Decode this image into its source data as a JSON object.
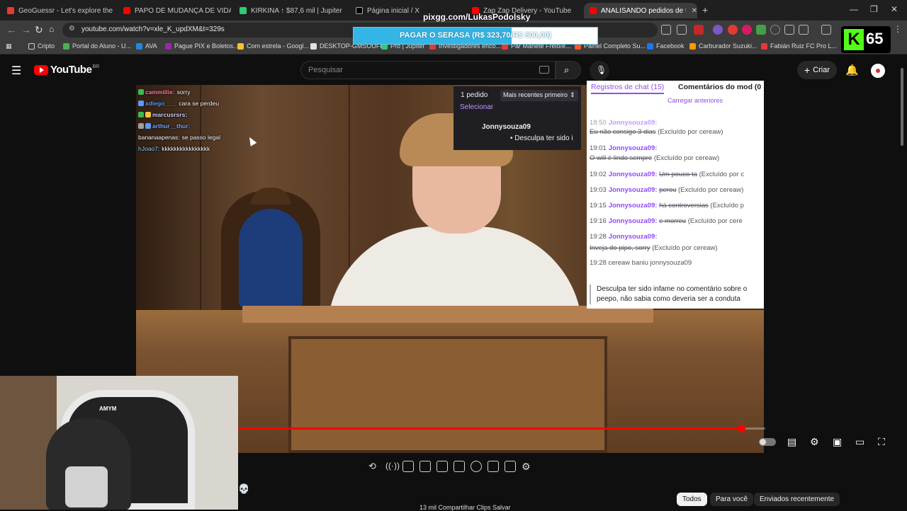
{
  "browser": {
    "tabs": [
      {
        "title": "GeoGuessr - Let's explore the world!",
        "color": "#e53935"
      },
      {
        "title": "PAPO DE MUDANÇA DE VIDA COM",
        "color": "#ff0000"
      },
      {
        "title": "KIRKINA ↑ $87,6 mil | Jupiter",
        "color": "#2ecc71"
      },
      {
        "title": "Página inicial / X",
        "color": "#000000"
      },
      {
        "title": "Zap Zap Delivery - YouTube",
        "color": "#ff0000"
      },
      {
        "title": "ANALISANDO pedidos de UN",
        "color": "#ff0000"
      }
    ],
    "url": "youtube.com/watch?v=xle_K_updXM&t=329s",
    "bookmarks": [
      {
        "label": "Cripto",
        "color": "#cccccc"
      },
      {
        "label": "Portal do Aluno - U...",
        "color": "#4caf50"
      },
      {
        "label": "AVA",
        "color": "#1e88e5"
      },
      {
        "label": "Pague PIX e Boletos...",
        "color": "#9c27b0"
      },
      {
        "label": "Com estrela - Googl...",
        "color": "#fbc02d"
      },
      {
        "label": "DESKTOP-GMSOUFF",
        "color": "#e0e0e0"
      },
      {
        "label": "Pro | Jupiter",
        "color": "#2ecc71"
      },
      {
        "label": "Investigadores enco...",
        "color": "#e53935"
      },
      {
        "label": "Par Manete Freio/e...",
        "color": "#e53935"
      },
      {
        "label": "Painel Completo Su...",
        "color": "#ff5722"
      },
      {
        "label": "Facebook",
        "color": "#1877f2"
      },
      {
        "label": "Carburador Suzuki...",
        "color": "#ff9800"
      },
      {
        "label": "Fabián Ruiz FC Pro L...",
        "color": "#e53935"
      }
    ]
  },
  "overlay": {
    "pix_handle": "pixgg.com/LukasPodolsky",
    "serasa_text": "PAGAR O SERASA (R$ 323,70/R$ 500,00)",
    "serasa_progress": 0.647,
    "kick_viewers": "65"
  },
  "youtube": {
    "logo_text": "YouTube",
    "region": "BR",
    "search_placeholder": "Pesquisar",
    "create_label": "Criar",
    "progress_fraction": 0.954,
    "chips": [
      "Todos",
      "Para você",
      "Enviados recentemente"
    ],
    "actions_partial": "13 mil      Compartilhar      Clips      Salvar"
  },
  "twitch_chat": [
    {
      "user": "cammiilie:",
      "msg": "sorry",
      "color": "#ff7bac"
    },
    {
      "user": "xdiego___:",
      "msg": "cara se perdeu",
      "color": "#5b9bff"
    },
    {
      "user": "marcusrsrs:",
      "msg": "",
      "color": "#cfcfff"
    },
    {
      "user": "arthur__thur:",
      "msg": "",
      "color": "#7aa7ff"
    },
    {
      "user": "bananaapenas:",
      "msg": "se passo legal",
      "color": "#ffffff"
    },
    {
      "user": "hJoao7:",
      "msg": "kkkkkkkkkkkkkkkk",
      "color": "#8fd4ff"
    }
  ],
  "mod_panel": {
    "request_count": "1 pedido",
    "sort": "Mais recentes primeiro",
    "select": "Selecionar",
    "request_user": "Jonnysouza09",
    "request_msg": "• Desculpa ter sido i",
    "tab_log": "Registros de chat (15)",
    "tab_comments": "Comentários do mod (0",
    "load_older": "Carregar anteriores",
    "log": [
      {
        "time": "18:50",
        "user": "Jonnysouza09:",
        "msg": "Eu não consigo 3 dias",
        "note": "(Excluído por cereaw)"
      },
      {
        "time": "19:01",
        "user": "Jonnysouza09:",
        "msg": "O will é lindo sempre",
        "note": "(Excluído por cereaw)"
      },
      {
        "time": "19:02",
        "user": "Jonnysouza09:",
        "msg": "Um pouco ta",
        "note": "(Excluído por c"
      },
      {
        "time": "19:03",
        "user": "Jonnysouza09:",
        "msg": "perou",
        "note": "(Excluído por cereaw)"
      },
      {
        "time": "19:15",
        "user": "Jonnysouza09:",
        "msg": "há controversias",
        "note": "(Excluído p"
      },
      {
        "time": "19:16",
        "user": "Jonnysouza09:",
        "msg": "e morreu",
        "note": "(Excluído por cere"
      },
      {
        "time": "19:28",
        "user": "Jonnysouza09:",
        "msg": "Inveja do pipo, sorry",
        "note": "(Excluído por cereaw)"
      }
    ],
    "ban": "19:28 cereaw baniu jonnysouza09",
    "quote": "Desculpa ter sido infame no comentário sobre o peepo, não sabia como deveria ser a conduta"
  },
  "webcam": {
    "chair_label": "AMYM"
  }
}
